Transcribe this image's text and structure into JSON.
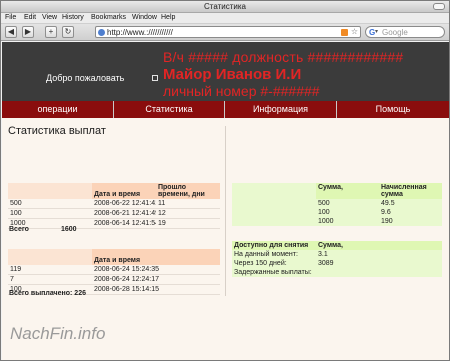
{
  "window": {
    "title": "Статистика"
  },
  "menu": {
    "items": [
      "File",
      "Edit",
      "View",
      "History",
      "Bookmarks",
      "Window",
      "Help"
    ]
  },
  "toolbar": {
    "back": "◀",
    "forward": "▶",
    "add": "+",
    "reload": "↻",
    "url": "http://www.:///////////",
    "search_engine": "G",
    "search_drop": "▾",
    "search_placeholder": "Google"
  },
  "banner": {
    "welcome": "Добро пожаловать",
    "line1": "В/ч #####   должность ############",
    "line2": "Майор Иванов И.И",
    "line3": "личный номер #-######"
  },
  "nav": {
    "items": [
      "операции",
      "Статистика",
      "Информация",
      "Помощь"
    ]
  },
  "content": {
    "title": "Статистика выплат",
    "payments_table": {
      "headers": [
        "",
        "Дата и время",
        "Прошло времени, дни"
      ],
      "rows": [
        [
          "500",
          "2008-06-22 12:41:41",
          "11"
        ],
        [
          "100",
          "2008-06-21 12:41:49",
          "12"
        ],
        [
          "1000",
          "2008-06-14 12:41:54",
          "19"
        ]
      ]
    },
    "total_label": "Всего",
    "total_value": "1600",
    "right_table": {
      "headers": [
        "",
        "Сумма,",
        "Начисленная сумма"
      ],
      "rows": [
        [
          "",
          "500",
          "49.5"
        ],
        [
          "",
          "100",
          "9.6"
        ],
        [
          "",
          "1000",
          "190"
        ]
      ]
    },
    "withdraw_table": {
      "headers": [
        "Доступно для снятия",
        "Сумма,"
      ],
      "rows": [
        [
          "На данный момент:",
          "3.1"
        ],
        [
          "Через 150 дней:",
          "3089"
        ],
        [
          "Задержанные выплаты:",
          ""
        ]
      ]
    },
    "paid_table": {
      "headers": [
        "",
        "Дата и время"
      ],
      "rows": [
        [
          "119",
          "2008-06-24 15:24:35"
        ],
        [
          "7",
          "2008-06-24 12:24:17"
        ],
        [
          "100",
          "2008-06-28 15:14:15"
        ]
      ]
    },
    "paid_total": "Всего выплачено: 226"
  },
  "watermark": "NachFin.info"
}
